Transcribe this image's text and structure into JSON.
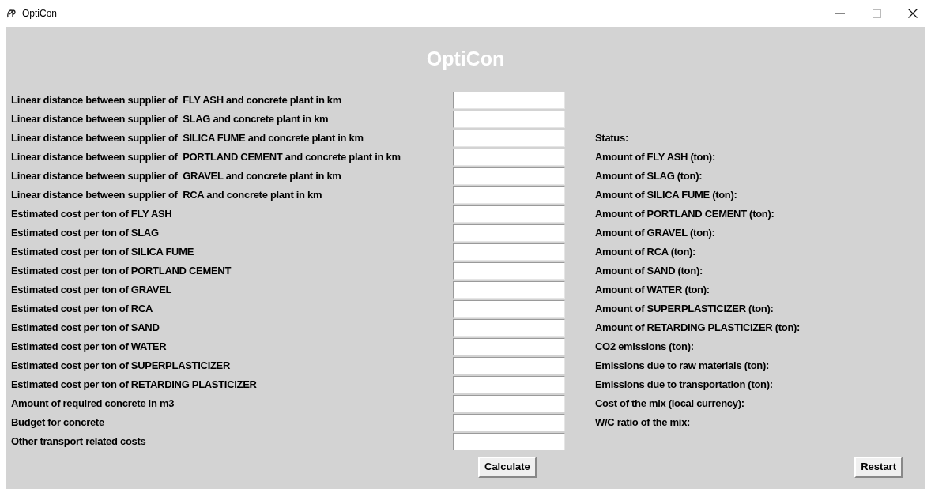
{
  "window": {
    "title": "OptiCon"
  },
  "header": "OptiCon",
  "fields": [
    {
      "label": "Linear distance between supplier of  FLY ASH and concrete plant in km"
    },
    {
      "label": "Linear distance between supplier of  SLAG and concrete plant in km"
    },
    {
      "label": "Linear distance between supplier of  SILICA FUME and concrete plant in km"
    },
    {
      "label": "Linear distance between supplier of  PORTLAND CEMENT and concrete plant in km"
    },
    {
      "label": "Linear distance between supplier of  GRAVEL and concrete plant in km"
    },
    {
      "label": "Linear distance between supplier of  RCA and concrete plant in km"
    },
    {
      "label": "Estimated cost per ton of FLY ASH"
    },
    {
      "label": "Estimated cost per ton of SLAG"
    },
    {
      "label": "Estimated cost per ton of SILICA FUME"
    },
    {
      "label": "Estimated cost per ton of PORTLAND CEMENT"
    },
    {
      "label": "Estimated cost per ton of GRAVEL"
    },
    {
      "label": "Estimated cost per ton of RCA"
    },
    {
      "label": "Estimated cost per ton of SAND"
    },
    {
      "label": "Estimated cost per ton of WATER"
    },
    {
      "label": "Estimated cost per ton of SUPERPLASTICIZER"
    },
    {
      "label": "Estimated cost per ton of RETARDING PLASTICIZER"
    },
    {
      "label": "Amount of required concrete in m3"
    },
    {
      "label": "Budget for concrete"
    },
    {
      "label": "Other transport related costs"
    }
  ],
  "results": [
    "Status:",
    "Amount of FLY ASH (ton):",
    "Amount of SLAG (ton):",
    "Amount of SILICA FUME (ton):",
    "Amount of PORTLAND CEMENT (ton):",
    "Amount of GRAVEL (ton):",
    "Amount of RCA (ton):",
    "Amount of SAND (ton):",
    "Amount of WATER (ton):",
    "Amount of SUPERPLASTICIZER (ton):",
    "Amount of RETARDING PLASTICIZER (ton):",
    "CO2 emissions (ton):",
    "Emissions due to raw materials (ton):",
    "Emissions due to transportation (ton):",
    "Cost of the mix (local currency):",
    "W/C ratio of the mix:"
  ],
  "buttons": {
    "calculate": "Calculate",
    "restart": "Restart"
  }
}
